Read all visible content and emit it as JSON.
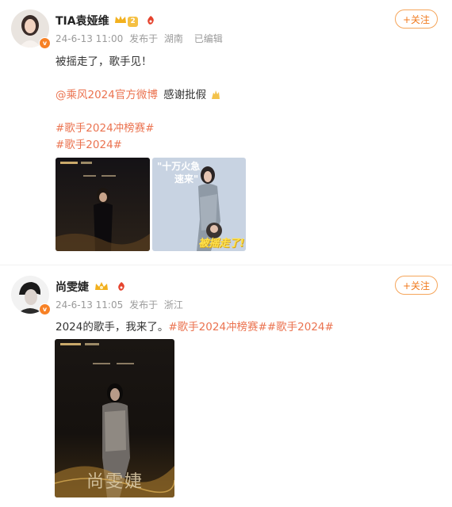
{
  "posts": [
    {
      "author": "TIA袁娅维",
      "vip_level": "2",
      "date": "24-6-13 11:00",
      "source_label": "发布于",
      "location": "湖南",
      "edited": "已编辑",
      "follow_label": "+关注",
      "line1": "被摇走了，歌手见！",
      "mention": "@乘风2024官方微博",
      "mention_suffix": "感谢批假",
      "hashtag1": "#歌手2024冲榜赛#",
      "hashtag2": "#歌手2024#",
      "image2_caption_top": "\"十万火急",
      "image2_caption_top2": "速来\"",
      "image2_caption_bottom": "被摇走了!"
    },
    {
      "author": "尚雯婕",
      "date": "24-6-13 11:05",
      "source_label": "发布于",
      "location": "浙江",
      "follow_label": "+关注",
      "text_prefix": "2024的歌手，我来了。",
      "hashtags": "#歌手2024冲榜赛##歌手2024#",
      "image_caption": "尚雯婕"
    }
  ],
  "colors": {
    "link": "#eb7350",
    "follow": "#f07a1e",
    "meta": "#9a9a9a"
  },
  "icons": {
    "verified": "orange-verified-badge",
    "crown": "crown-icon",
    "mascot": "mascot-icon"
  }
}
